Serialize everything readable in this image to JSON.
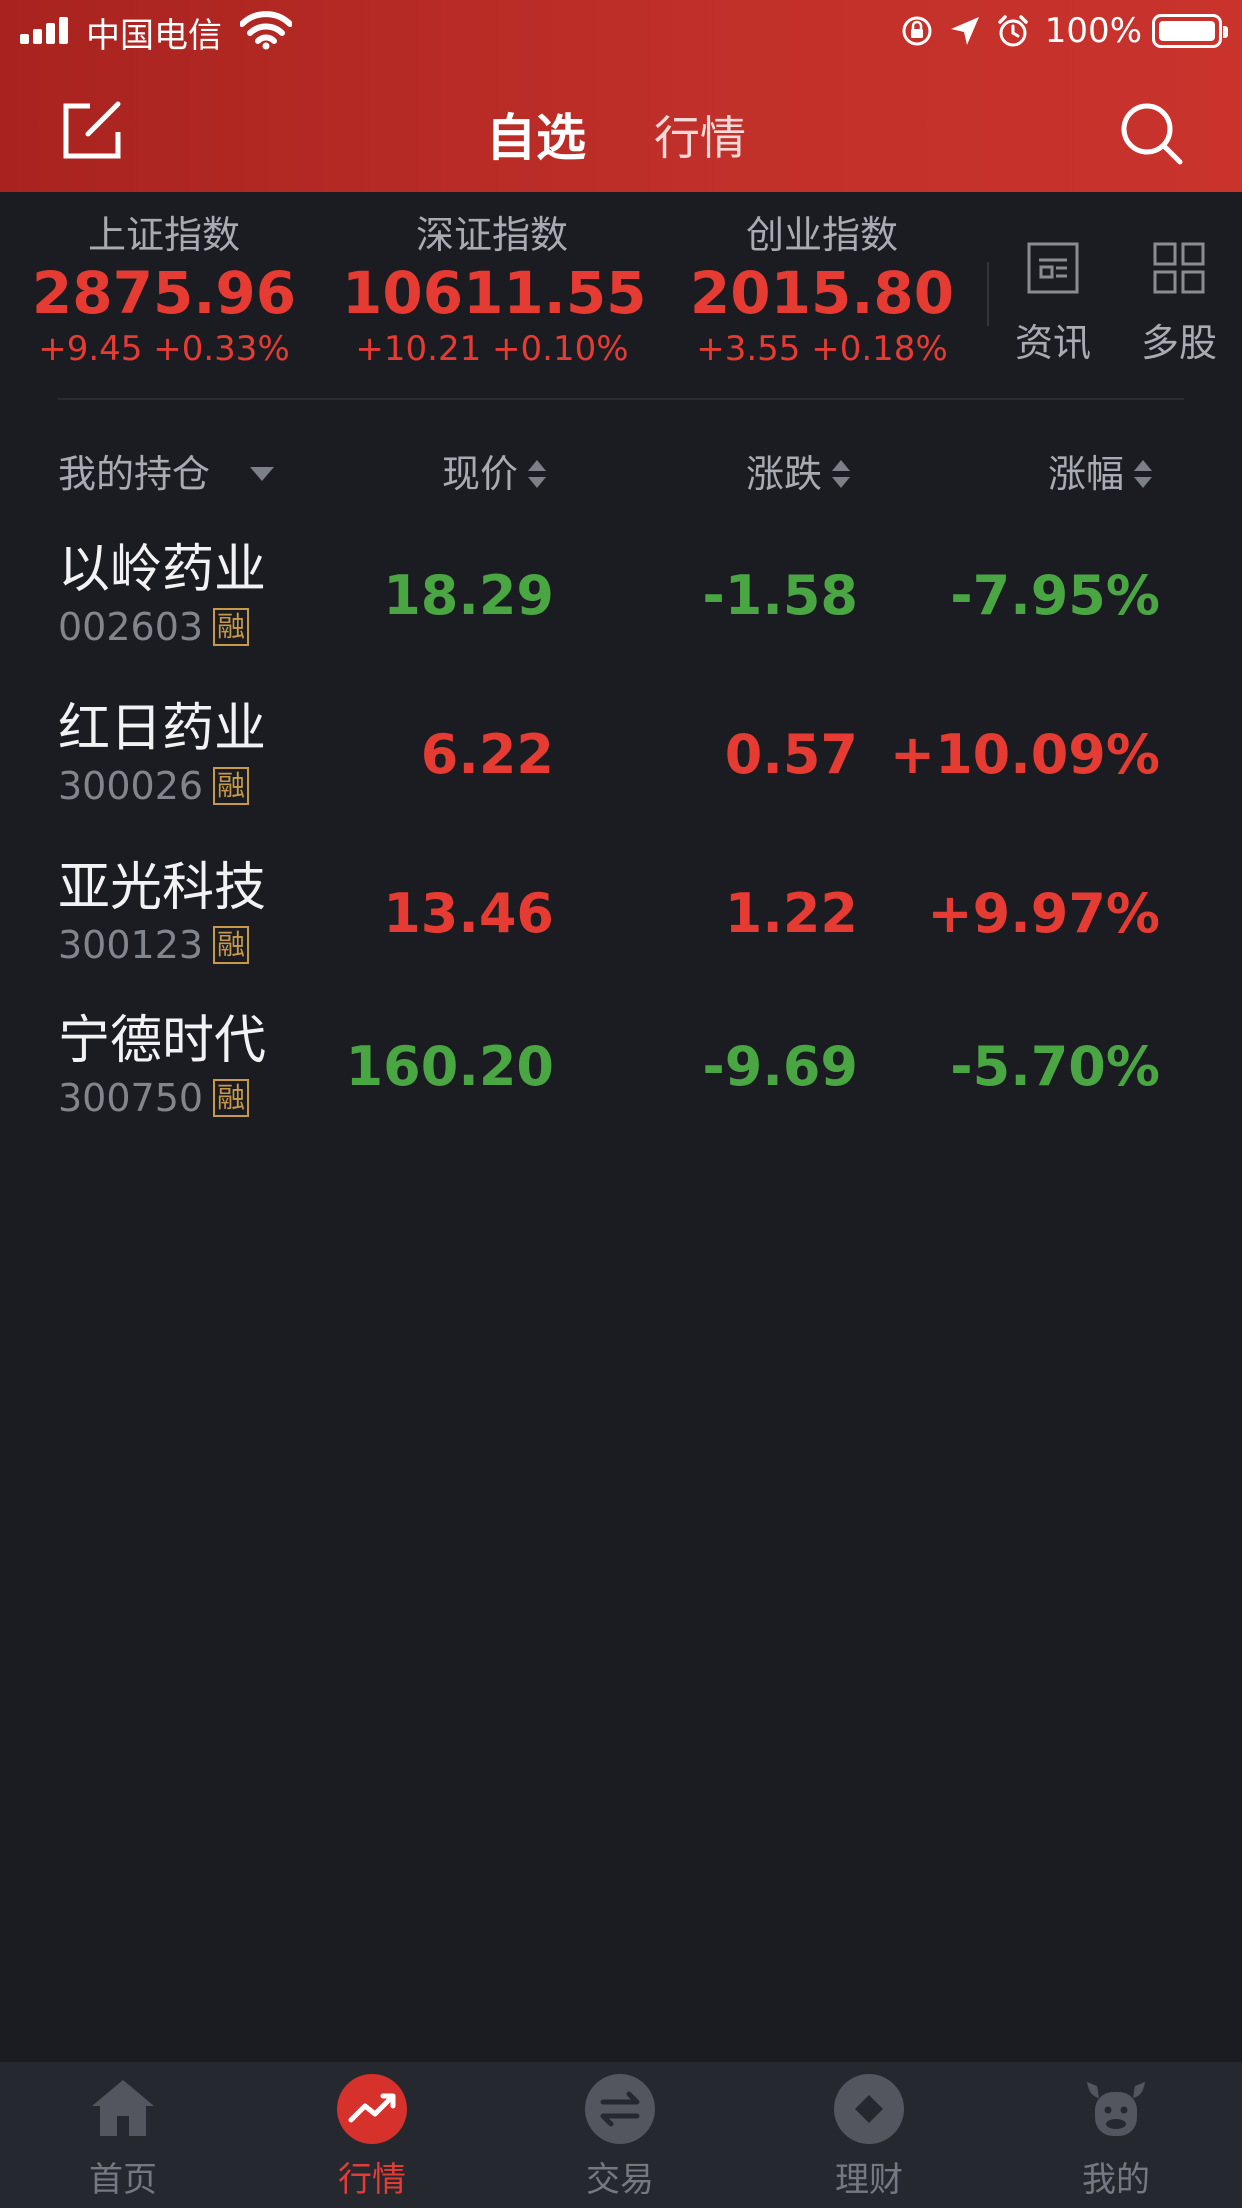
{
  "status_bar": {
    "carrier": "中国电信",
    "battery": "100%"
  },
  "header": {
    "tab_watchlist": "自选",
    "tab_market": "行情",
    "accent_color": "#c2302a"
  },
  "indices": [
    {
      "name": "上证指数",
      "value": "2875.96",
      "change": "+9.45 +0.33%"
    },
    {
      "name": "深证指数",
      "value": "10611.55",
      "change": "+10.21 +0.10%"
    },
    {
      "name": "创业指数",
      "value": "2015.80",
      "change": "+3.55 +0.18%"
    }
  ],
  "quick_links": {
    "news": "资讯",
    "multi": "多股"
  },
  "table": {
    "group": "我的持仓",
    "col_price": "现价",
    "col_change": "涨跌",
    "col_pct": "涨幅",
    "up_color": "#e63b33",
    "down_color": "#4aa543",
    "rows": [
      {
        "name": "以岭药业",
        "code": "002603",
        "tag": "融",
        "price": "18.29",
        "change": "-1.58",
        "pct": "-7.95%",
        "direction": "down"
      },
      {
        "name": "红日药业",
        "code": "300026",
        "tag": "融",
        "price": "6.22",
        "change": "0.57",
        "pct": "+10.09%",
        "direction": "up"
      },
      {
        "name": "亚光科技",
        "code": "300123",
        "tag": "融",
        "price": "13.46",
        "change": "1.22",
        "pct": "+9.97%",
        "direction": "up"
      },
      {
        "name": "宁德时代",
        "code": "300750",
        "tag": "融",
        "price": "160.20",
        "change": "-9.69",
        "pct": "-5.70%",
        "direction": "down"
      }
    ]
  },
  "bottom_nav": {
    "home": "首页",
    "market": "行情",
    "trade": "交易",
    "wealth": "理财",
    "mine": "我的"
  }
}
